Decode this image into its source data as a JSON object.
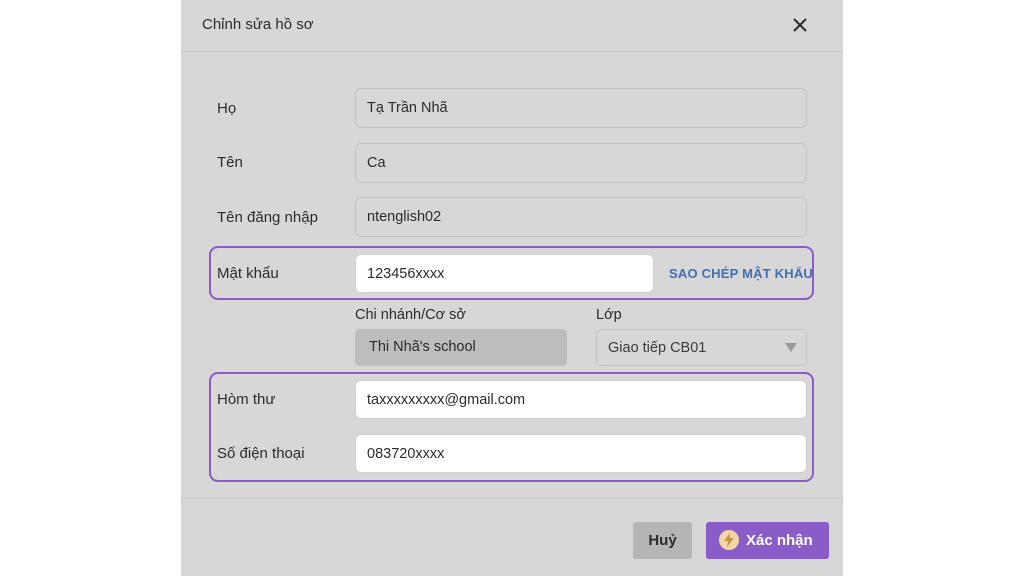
{
  "dialog": {
    "title": "Chỉnh sửa hồ sơ"
  },
  "form": {
    "last_name": {
      "label": "Họ",
      "value": "Tạ Trần Nhã"
    },
    "first_name": {
      "label": "Tên",
      "value": "Ca"
    },
    "username": {
      "label": "Tên đăng nhập",
      "value": "ntenglish02"
    },
    "password": {
      "label": "Mật khẩu",
      "value": "123456xxxx",
      "copy_label": "SAO CHÉP MẬT KHẨU"
    },
    "branch": {
      "label": "Chi nhánh/Cơ sở",
      "value": "Thi Nhã's school"
    },
    "class": {
      "label": "Lớp",
      "value": "Giao tiếp CB01"
    },
    "email": {
      "label": "Hòm thư",
      "value": "taxxxxxxxxx@gmail.com"
    },
    "phone": {
      "label": "Số điện thoại",
      "value": "083720xxxx"
    }
  },
  "footer": {
    "cancel_label": "Huỷ",
    "confirm_label": "Xác nhận"
  },
  "colors": {
    "accent": "#8a5cc8",
    "link": "#3f6fb5",
    "backdrop": "#d7d7d7"
  },
  "icons": {
    "close": "close-icon",
    "caret": "caret-down-icon",
    "confirm": "bolt-icon"
  }
}
